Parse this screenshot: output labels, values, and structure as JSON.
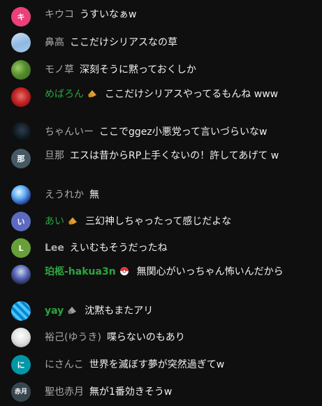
{
  "colors": {
    "background": "#0f0f0f",
    "author_default": "#aaaaaa",
    "author_member": "#2ba640",
    "message_text": "#f1f1f1"
  },
  "messages": [
    {
      "author": "キウコ",
      "text": "うすいなぁw",
      "avatar_letter": "キ",
      "avatar_color": "#ec407a",
      "member": false
    },
    {
      "author": "鼻高",
      "text": "ここだけシリアスなの草",
      "avatar_letter": "",
      "avatar_icon": "sky-photo-avatar",
      "member": false
    },
    {
      "author": "モノ草",
      "text": "深刻そうに黙っておくしか",
      "avatar_letter": "",
      "avatar_icon": "plant-photo-avatar",
      "member": false
    },
    {
      "author": "めばろん",
      "text": "ここだけシリアスやってるもんね www",
      "avatar_letter": "",
      "avatar_icon": "red-flower-avatar",
      "member": true,
      "badge_icon": "gold-member-badge-icon"
    },
    {
      "author": "ちゃんいー",
      "text": "ここでggez小悪党って言いづらいなw",
      "avatar_letter": "",
      "avatar_icon": "dark-photo-avatar",
      "member": false
    },
    {
      "author": "旦那",
      "text": "エスは昔からRP上手くないの！許してあげて w",
      "avatar_letter": "那",
      "avatar_color": "#455a64",
      "member": false
    },
    {
      "author": "えうれか",
      "text": "無",
      "avatar_letter": "",
      "avatar_icon": "anime-character-avatar",
      "member": false
    },
    {
      "author": "あい",
      "text": "三幻神しちゃったって感じだよな",
      "avatar_letter": "い",
      "avatar_color": "#5c6bc0",
      "member": true,
      "badge_icon": "gold-member-badge-icon"
    },
    {
      "author": "Lee",
      "text": "えいむもそうだったね",
      "avatar_letter": "L",
      "avatar_color": "#689f38",
      "member": false
    },
    {
      "author": "珀柩-hakua3n",
      "text": "無関心がいっちゃん怖いんだから",
      "avatar_letter": "",
      "avatar_icon": "anime-girl-avatar",
      "member": true,
      "badge_icon": "red-member-badge-icon"
    },
    {
      "author": "yay",
      "text": "沈黙もまたアリ",
      "avatar_letter": "",
      "avatar_icon": "blue-pattern-avatar",
      "member": true,
      "badge_icon": "grey-member-badge-icon"
    },
    {
      "author": "裕己(ゆうき)",
      "text": "喋らないのもあり",
      "avatar_letter": "",
      "avatar_icon": "white-figure-avatar",
      "member": false
    },
    {
      "author": "にさんこ",
      "text": "世界を滅ぼす夢が突然過ぎてw",
      "avatar_letter": "に",
      "avatar_color": "#0097a7",
      "member": false
    },
    {
      "author": "聖也赤月",
      "text": "無が1番効きそうw",
      "avatar_letter": "赤月",
      "avatar_color": "#37474f",
      "member": false
    }
  ]
}
